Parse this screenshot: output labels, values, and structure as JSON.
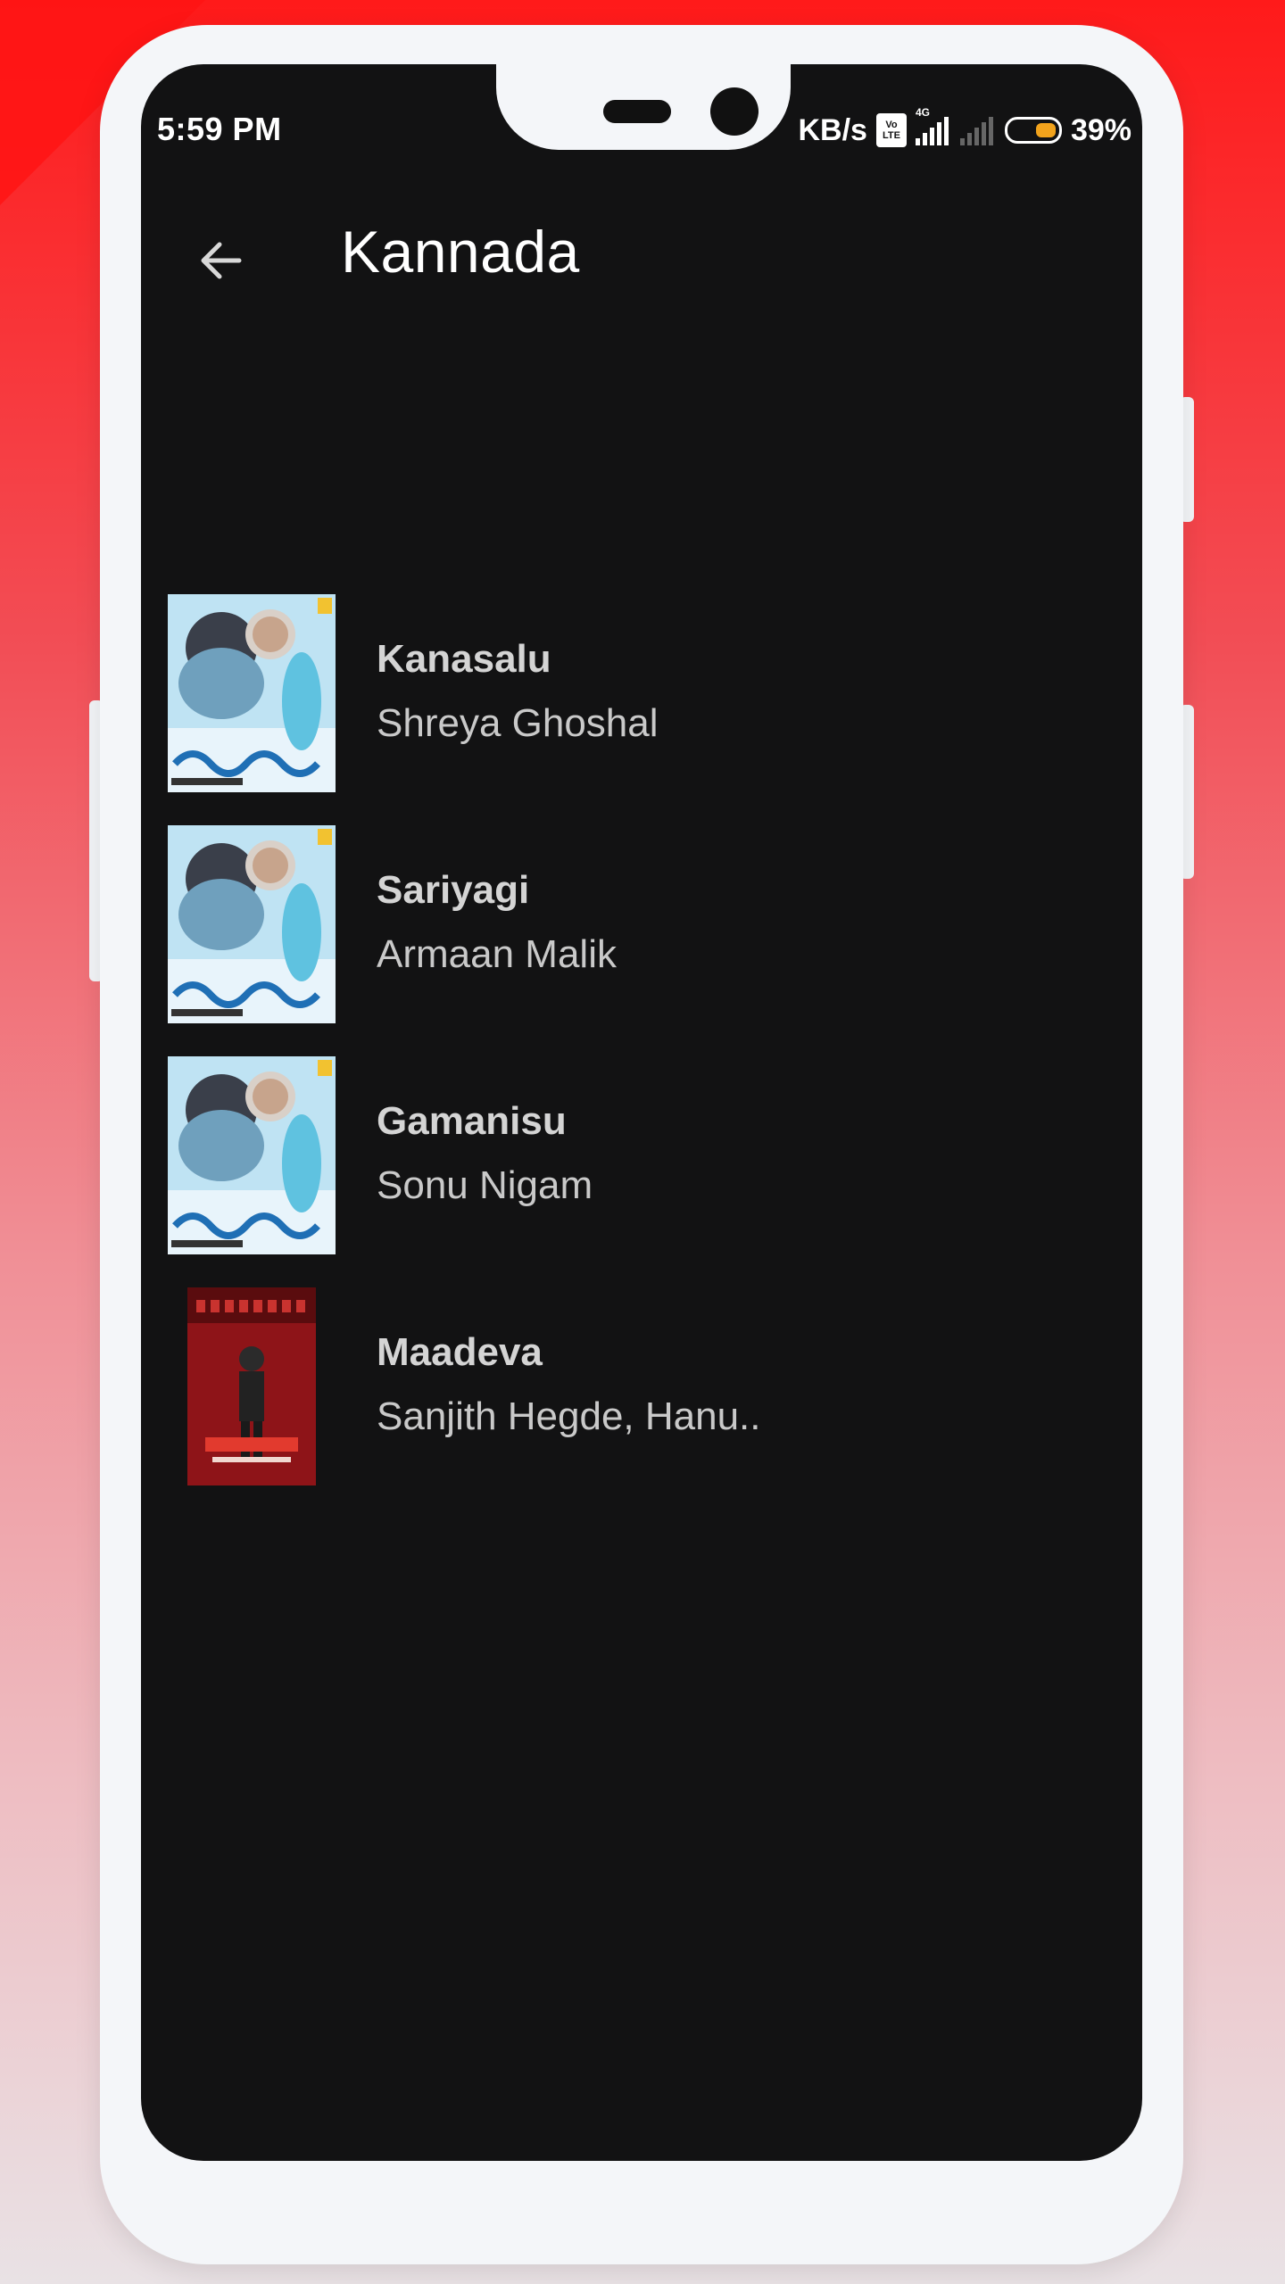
{
  "status_bar": {
    "time": "5:59 PM",
    "network_speed": "KB/s",
    "volte_top": "Vo",
    "volte_bottom": "LTE",
    "network_type": "4G",
    "battery_percent": "39%",
    "battery_level": 0.39,
    "colors": {
      "battery_fill": "#f2a31c"
    }
  },
  "app_bar": {
    "title": "Kannada",
    "back_icon": "arrow-left-icon"
  },
  "songs": [
    {
      "title": "Kanasalu",
      "artist": "Shreya Ghoshal",
      "artwork": "album-art"
    },
    {
      "title": "Sariyagi",
      "artist": "Armaan Malik",
      "artwork": "album-art"
    },
    {
      "title": "Gamanisu",
      "artist": "Sonu Nigam",
      "artwork": "album-art"
    },
    {
      "title": "Maadeva",
      "artist": "Sanjith Hegde, Hanu..",
      "artwork": "movie-poster"
    }
  ],
  "colors": {
    "screen_background": "#121213",
    "title_text": "#ffffff",
    "song_text": "#d4d4d4",
    "frame": "#f4f6f9",
    "page_gradient_top": "#ff1a1a",
    "page_gradient_bottom": "#e9e2e5"
  }
}
